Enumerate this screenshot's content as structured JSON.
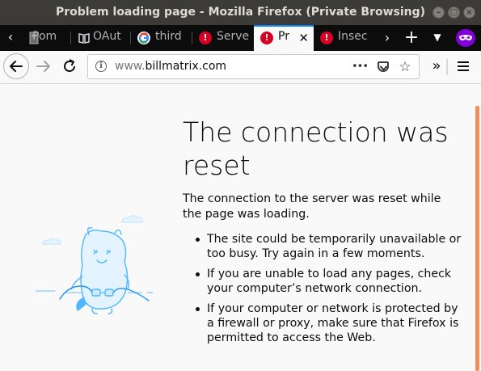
{
  "window": {
    "title": "Problem loading page - Mozilla Firefox (Private Browsing)"
  },
  "tabs": [
    {
      "label": "Pom",
      "icon": "page-icon",
      "active": false
    },
    {
      "label": "OAut",
      "icon": "book-icon",
      "active": false
    },
    {
      "label": "third",
      "icon": "google-icon",
      "active": false
    },
    {
      "label": "Serve",
      "icon": "error-icon",
      "active": false
    },
    {
      "label": "Pr",
      "icon": "error-icon",
      "active": true
    },
    {
      "label": "Insec",
      "icon": "error-icon",
      "active": false
    }
  ],
  "navbar": {
    "url_prefix": "www.",
    "url_host": "billmatrix.com",
    "page_actions_label": "•••"
  },
  "error": {
    "title": "The connection was reset",
    "description": "The connection to the server was reset while the page was loading.",
    "bullets": [
      "The site could be temporarily unavailable or too busy. Try again in a few moments.",
      "If you are unable to load any pages, check your computer’s network connection.",
      "If your computer or network is protected by a firewall or proxy, make sure that Firefox is permitted to access the Web."
    ]
  },
  "colors": {
    "tab_highlight": "#0a84ff",
    "error_icon": "#d70022",
    "private_badge": "#8000d7",
    "scroll_indicator": "#f28e5b",
    "illustration": "#4db8ff"
  }
}
